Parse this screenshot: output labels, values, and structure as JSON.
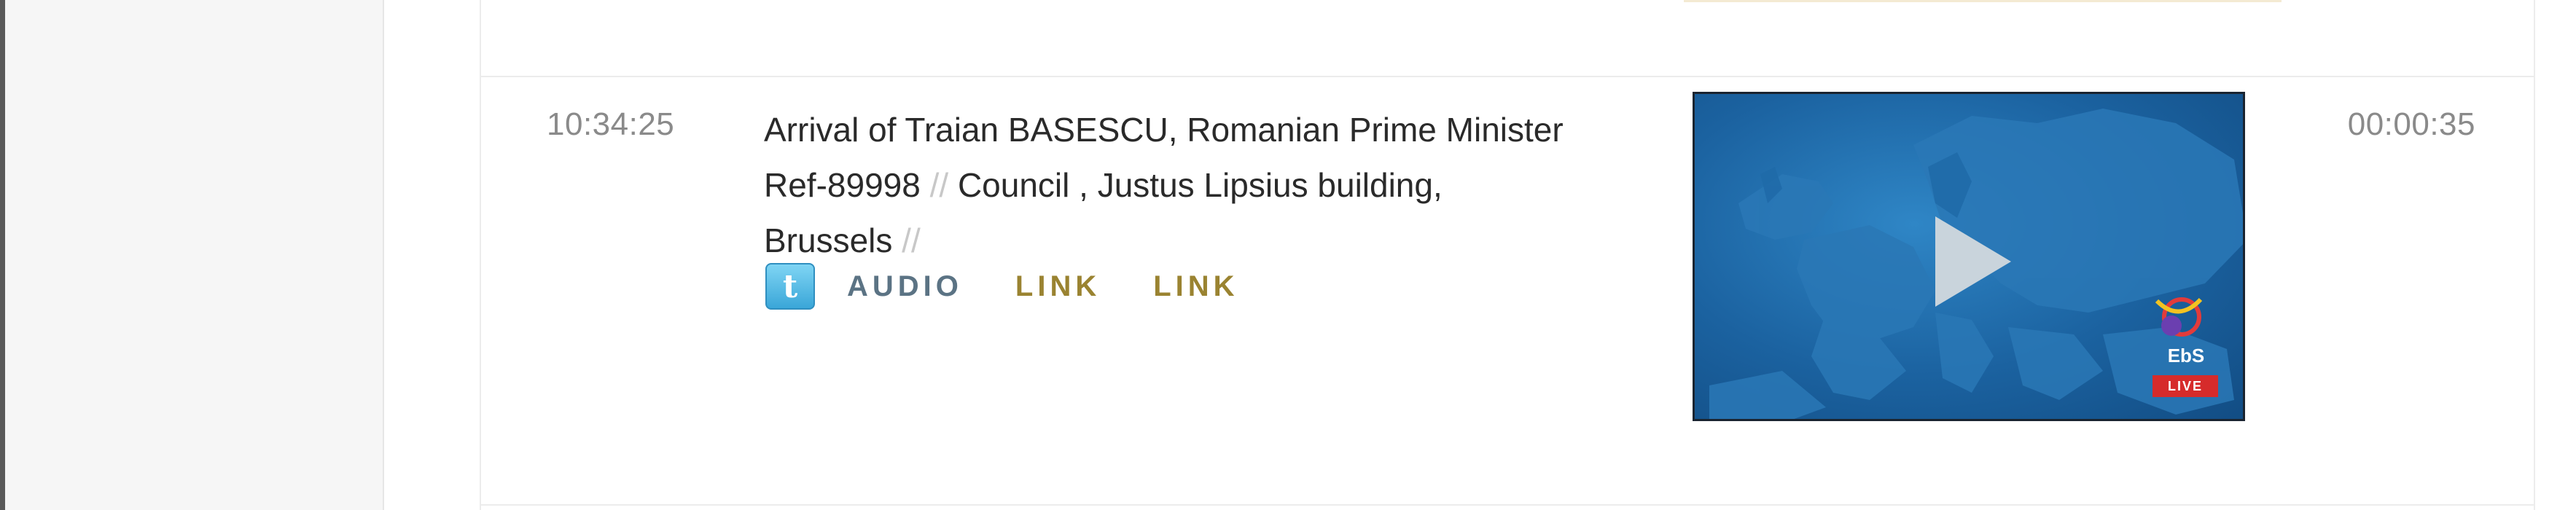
{
  "entry": {
    "time": "10:34:25",
    "duration": "00:00:35",
    "title": "Arrival of Traian BASESCU, Romanian Prime Minister",
    "ref": "Ref-89998",
    "separator": "//",
    "location_part1": "Council , Justus Lipsius building,",
    "location_part2": "Brussels",
    "actions": {
      "twitter_glyph": "t",
      "audio": "AUDIO",
      "link1": "LINK",
      "link2": "LINK"
    },
    "video": {
      "logo_text": "EbS",
      "live_badge": "LIVE",
      "icons": [
        "play-icon",
        "ebs-logo-icon",
        "twitter-icon"
      ]
    }
  },
  "colors": {
    "time_text": "#8a8a8a",
    "audio": "#5b7384",
    "link": "#9a8331",
    "thumb_blue": "#1b62a0",
    "live_red": "#d62b2b"
  }
}
